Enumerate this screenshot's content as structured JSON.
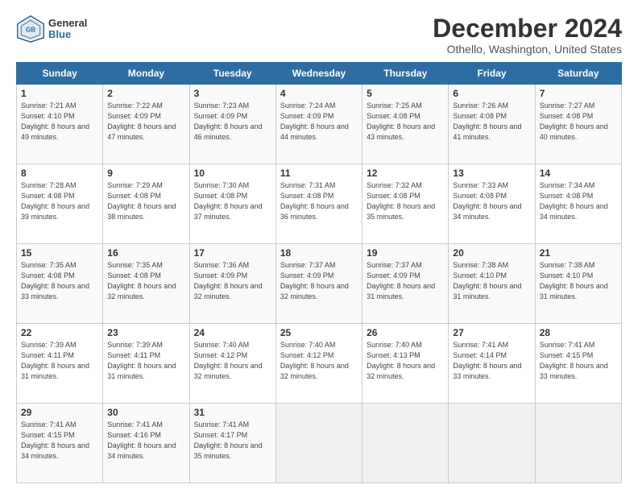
{
  "logo": {
    "general": "General",
    "blue": "Blue"
  },
  "header": {
    "title": "December 2024",
    "subtitle": "Othello, Washington, United States"
  },
  "days_of_week": [
    "Sunday",
    "Monday",
    "Tuesday",
    "Wednesday",
    "Thursday",
    "Friday",
    "Saturday"
  ],
  "weeks": [
    [
      {
        "day": "1",
        "info": "Sunrise: 7:21 AM\nSunset: 4:10 PM\nDaylight: 8 hours and 49 minutes."
      },
      {
        "day": "2",
        "info": "Sunrise: 7:22 AM\nSunset: 4:09 PM\nDaylight: 8 hours and 47 minutes."
      },
      {
        "day": "3",
        "info": "Sunrise: 7:23 AM\nSunset: 4:09 PM\nDaylight: 8 hours and 46 minutes."
      },
      {
        "day": "4",
        "info": "Sunrise: 7:24 AM\nSunset: 4:09 PM\nDaylight: 8 hours and 44 minutes."
      },
      {
        "day": "5",
        "info": "Sunrise: 7:25 AM\nSunset: 4:08 PM\nDaylight: 8 hours and 43 minutes."
      },
      {
        "day": "6",
        "info": "Sunrise: 7:26 AM\nSunset: 4:08 PM\nDaylight: 8 hours and 41 minutes."
      },
      {
        "day": "7",
        "info": "Sunrise: 7:27 AM\nSunset: 4:08 PM\nDaylight: 8 hours and 40 minutes."
      }
    ],
    [
      {
        "day": "8",
        "info": "Sunrise: 7:28 AM\nSunset: 4:08 PM\nDaylight: 8 hours and 39 minutes."
      },
      {
        "day": "9",
        "info": "Sunrise: 7:29 AM\nSunset: 4:08 PM\nDaylight: 8 hours and 38 minutes."
      },
      {
        "day": "10",
        "info": "Sunrise: 7:30 AM\nSunset: 4:08 PM\nDaylight: 8 hours and 37 minutes."
      },
      {
        "day": "11",
        "info": "Sunrise: 7:31 AM\nSunset: 4:08 PM\nDaylight: 8 hours and 36 minutes."
      },
      {
        "day": "12",
        "info": "Sunrise: 7:32 AM\nSunset: 4:08 PM\nDaylight: 8 hours and 35 minutes."
      },
      {
        "day": "13",
        "info": "Sunrise: 7:33 AM\nSunset: 4:08 PM\nDaylight: 8 hours and 34 minutes."
      },
      {
        "day": "14",
        "info": "Sunrise: 7:34 AM\nSunset: 4:08 PM\nDaylight: 8 hours and 34 minutes."
      }
    ],
    [
      {
        "day": "15",
        "info": "Sunrise: 7:35 AM\nSunset: 4:08 PM\nDaylight: 8 hours and 33 minutes."
      },
      {
        "day": "16",
        "info": "Sunrise: 7:35 AM\nSunset: 4:08 PM\nDaylight: 8 hours and 32 minutes."
      },
      {
        "day": "17",
        "info": "Sunrise: 7:36 AM\nSunset: 4:09 PM\nDaylight: 8 hours and 32 minutes."
      },
      {
        "day": "18",
        "info": "Sunrise: 7:37 AM\nSunset: 4:09 PM\nDaylight: 8 hours and 32 minutes."
      },
      {
        "day": "19",
        "info": "Sunrise: 7:37 AM\nSunset: 4:09 PM\nDaylight: 8 hours and 31 minutes."
      },
      {
        "day": "20",
        "info": "Sunrise: 7:38 AM\nSunset: 4:10 PM\nDaylight: 8 hours and 31 minutes."
      },
      {
        "day": "21",
        "info": "Sunrise: 7:38 AM\nSunset: 4:10 PM\nDaylight: 8 hours and 31 minutes."
      }
    ],
    [
      {
        "day": "22",
        "info": "Sunrise: 7:39 AM\nSunset: 4:11 PM\nDaylight: 8 hours and 31 minutes."
      },
      {
        "day": "23",
        "info": "Sunrise: 7:39 AM\nSunset: 4:11 PM\nDaylight: 8 hours and 31 minutes."
      },
      {
        "day": "24",
        "info": "Sunrise: 7:40 AM\nSunset: 4:12 PM\nDaylight: 8 hours and 32 minutes."
      },
      {
        "day": "25",
        "info": "Sunrise: 7:40 AM\nSunset: 4:12 PM\nDaylight: 8 hours and 32 minutes."
      },
      {
        "day": "26",
        "info": "Sunrise: 7:40 AM\nSunset: 4:13 PM\nDaylight: 8 hours and 32 minutes."
      },
      {
        "day": "27",
        "info": "Sunrise: 7:41 AM\nSunset: 4:14 PM\nDaylight: 8 hours and 33 minutes."
      },
      {
        "day": "28",
        "info": "Sunrise: 7:41 AM\nSunset: 4:15 PM\nDaylight: 8 hours and 33 minutes."
      }
    ],
    [
      {
        "day": "29",
        "info": "Sunrise: 7:41 AM\nSunset: 4:15 PM\nDaylight: 8 hours and 34 minutes."
      },
      {
        "day": "30",
        "info": "Sunrise: 7:41 AM\nSunset: 4:16 PM\nDaylight: 8 hours and 34 minutes."
      },
      {
        "day": "31",
        "info": "Sunrise: 7:41 AM\nSunset: 4:17 PM\nDaylight: 8 hours and 35 minutes."
      },
      {
        "day": "",
        "info": ""
      },
      {
        "day": "",
        "info": ""
      },
      {
        "day": "",
        "info": ""
      },
      {
        "day": "",
        "info": ""
      }
    ]
  ]
}
